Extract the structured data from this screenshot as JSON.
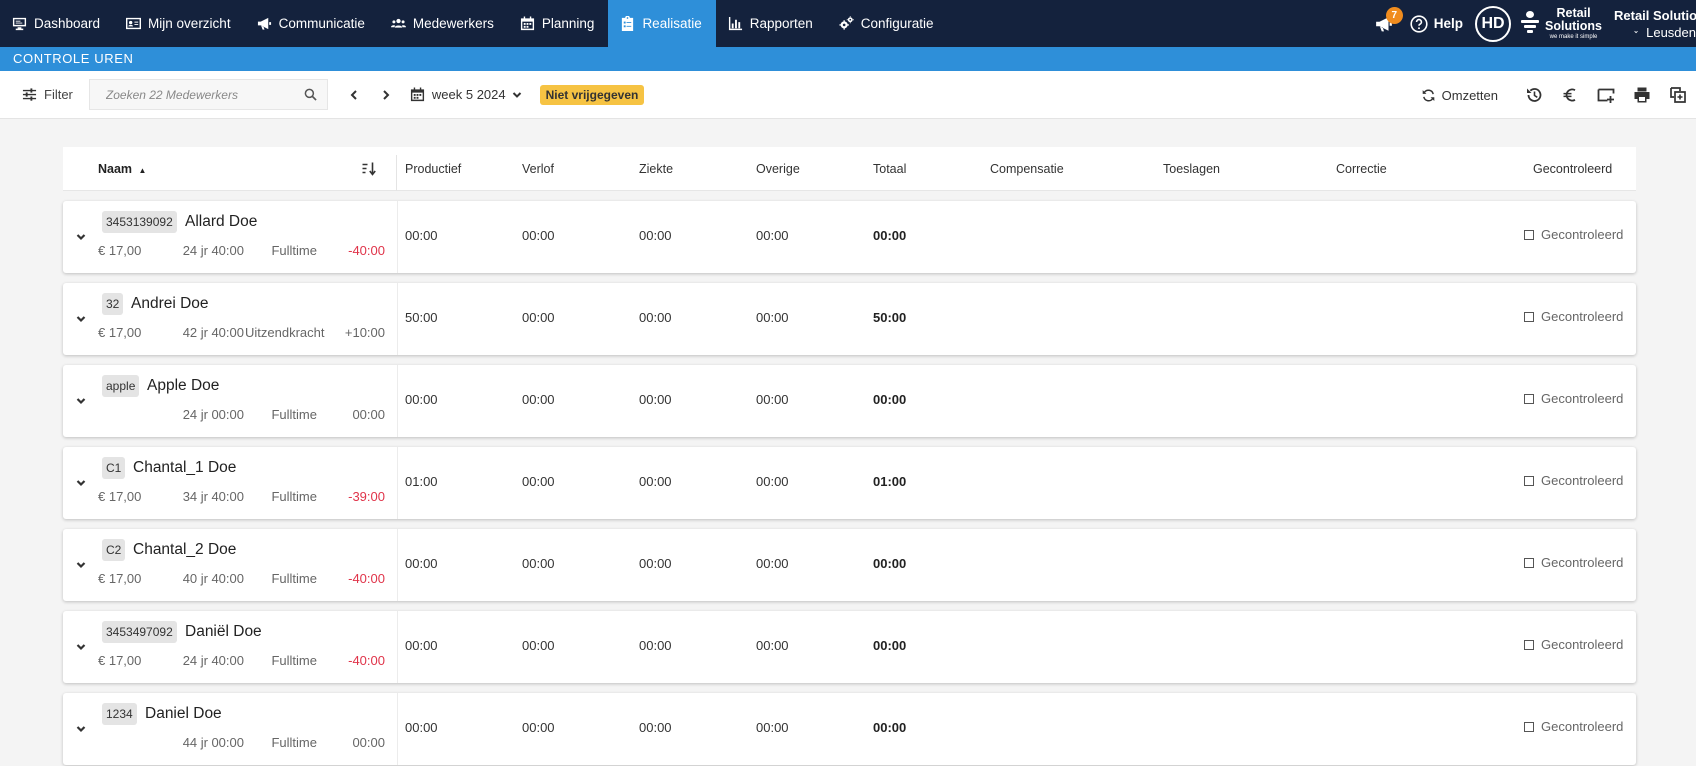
{
  "nav": {
    "items": [
      {
        "label": "Dashboard",
        "icon": "monitor-icon",
        "active": false
      },
      {
        "label": "Mijn overzicht",
        "icon": "id-card-icon",
        "active": false
      },
      {
        "label": "Communicatie",
        "icon": "megaphone-icon",
        "active": false
      },
      {
        "label": "Medewerkers",
        "icon": "users-icon",
        "active": false
      },
      {
        "label": "Planning",
        "icon": "calendar-icon",
        "active": false
      },
      {
        "label": "Realisatie",
        "icon": "clipboard-icon",
        "active": true
      },
      {
        "label": "Rapporten",
        "icon": "bar-chart-icon",
        "active": false
      },
      {
        "label": "Configuratie",
        "icon": "gears-icon",
        "active": false
      }
    ],
    "notification_count": "7",
    "help_label": "Help",
    "avatar_initials": "HD",
    "logo_line1": "Retail",
    "logo_line2": "Solutions",
    "logo_tagline": "we make it simple",
    "store_name": "Retail Solutions",
    "store_location": "Leusden"
  },
  "subheader": {
    "title": "CONTROLE UREN"
  },
  "toolbar": {
    "filter_label": "Filter",
    "search_placeholder": "Zoeken 22 Medewerkers",
    "week_label": "week 5 2024",
    "status_badge": "Niet vrijgegeven",
    "omzetten_label": "Omzetten",
    "colors": {
      "badge": "#f6c343",
      "accent": "#2e8fd9",
      "nav_bg": "#14223d",
      "negative": "#e0344a"
    }
  },
  "table": {
    "headers": {
      "naam": "Naam",
      "productief": "Productief",
      "verlof": "Verlof",
      "ziekte": "Ziekte",
      "overige": "Overige",
      "totaal": "Totaal",
      "compensatie": "Compensatie",
      "toeslagen": "Toeslagen",
      "correctie": "Correctie",
      "gecontroleerd": "Gecontroleerd"
    },
    "check_label": "Gecontroleerd",
    "rows": [
      {
        "id": "3453139092",
        "name": "Allard Doe",
        "wage": "€ 17,00",
        "age": "24 jr",
        "contract": "40:00",
        "type": "Fulltime",
        "diff": "-40:00",
        "diff_negative": true,
        "productief": "00:00",
        "verlof": "00:00",
        "ziekte": "00:00",
        "overige": "00:00",
        "totaal": "00:00"
      },
      {
        "id": "32",
        "name": "Andrei Doe",
        "wage": "€ 17,00",
        "age": "42 jr",
        "contract": "40:00",
        "type": "Uitzendkracht",
        "diff": "+10:00",
        "diff_negative": false,
        "productief": "50:00",
        "verlof": "00:00",
        "ziekte": "00:00",
        "overige": "00:00",
        "totaal": "50:00"
      },
      {
        "id": "apple",
        "name": "Apple Doe",
        "wage": "",
        "age": "24 jr",
        "contract": "00:00",
        "type": "Fulltime",
        "diff": "00:00",
        "diff_negative": false,
        "productief": "00:00",
        "verlof": "00:00",
        "ziekte": "00:00",
        "overige": "00:00",
        "totaal": "00:00"
      },
      {
        "id": "C1",
        "name": "Chantal_1 Doe",
        "wage": "€ 17,00",
        "age": "34 jr",
        "contract": "40:00",
        "type": "Fulltime",
        "diff": "-39:00",
        "diff_negative": true,
        "productief": "01:00",
        "verlof": "00:00",
        "ziekte": "00:00",
        "overige": "00:00",
        "totaal": "01:00"
      },
      {
        "id": "C2",
        "name": "Chantal_2 Doe",
        "wage": "€ 17,00",
        "age": "40 jr",
        "contract": "40:00",
        "type": "Fulltime",
        "diff": "-40:00",
        "diff_negative": true,
        "productief": "00:00",
        "verlof": "00:00",
        "ziekte": "00:00",
        "overige": "00:00",
        "totaal": "00:00"
      },
      {
        "id": "3453497092",
        "name": "Daniël Doe",
        "wage": "€ 17,00",
        "age": "24 jr",
        "contract": "40:00",
        "type": "Fulltime",
        "diff": "-40:00",
        "diff_negative": true,
        "productief": "00:00",
        "verlof": "00:00",
        "ziekte": "00:00",
        "overige": "00:00",
        "totaal": "00:00"
      },
      {
        "id": "1234",
        "name": "Daniel Doe",
        "wage": "",
        "age": "44 jr",
        "contract": "00:00",
        "type": "Fulltime",
        "diff": "00:00",
        "diff_negative": false,
        "productief": "00:00",
        "verlof": "00:00",
        "ziekte": "00:00",
        "overige": "00:00",
        "totaal": "00:00"
      }
    ]
  }
}
